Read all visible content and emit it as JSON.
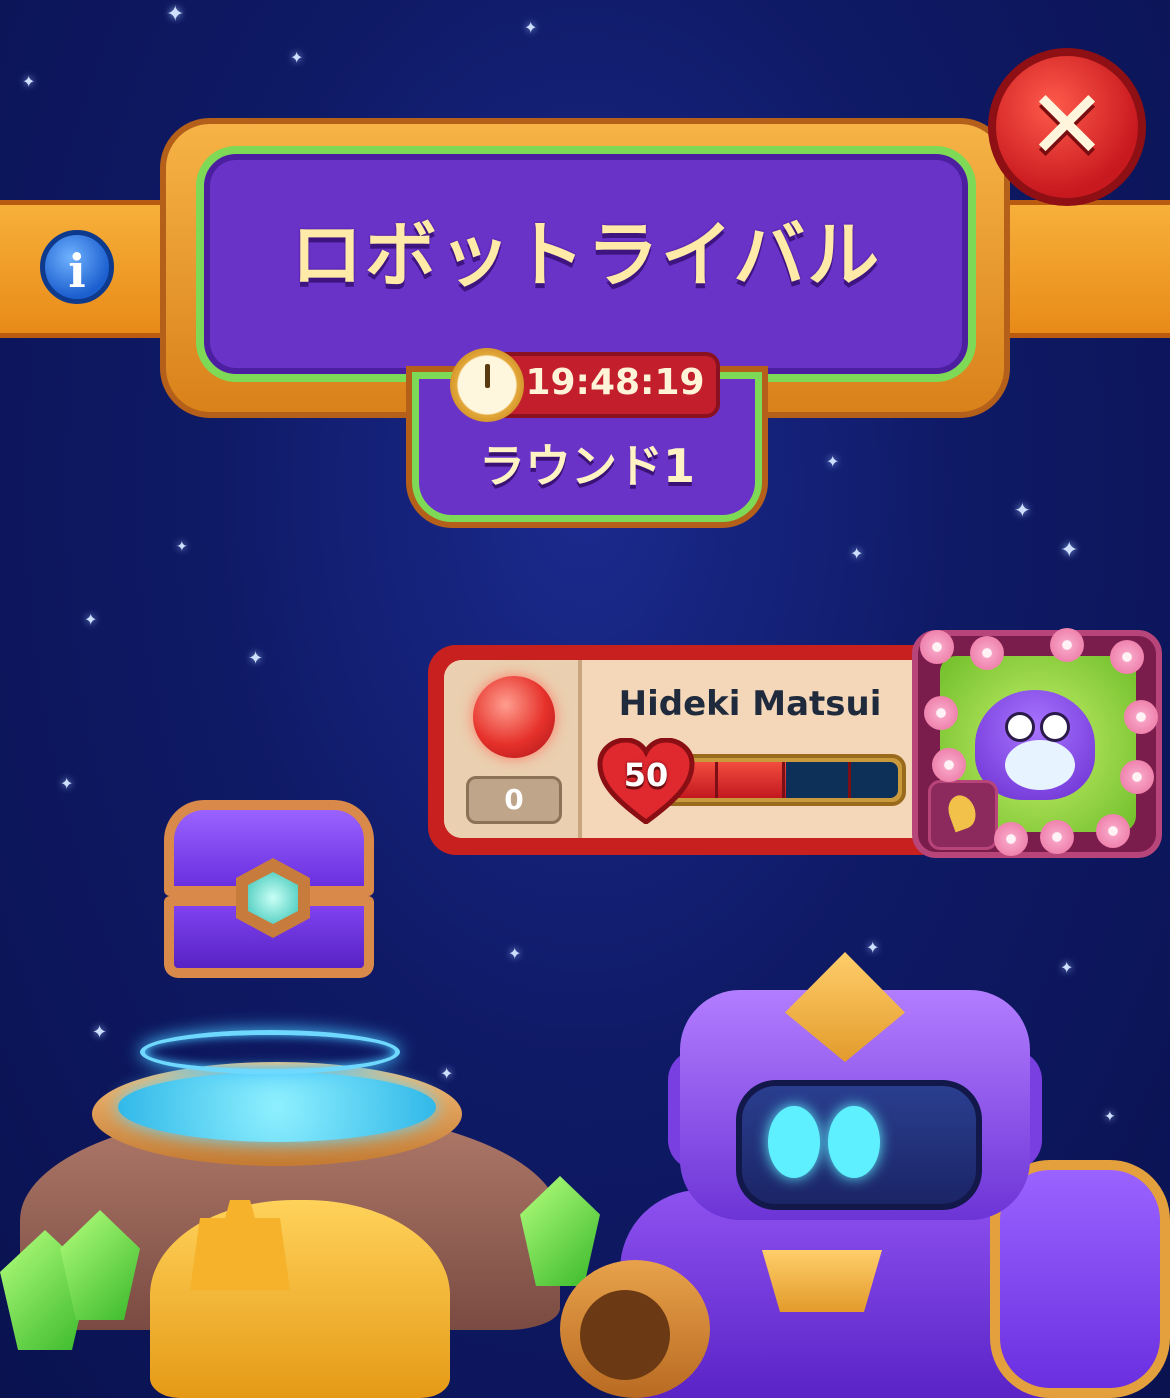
{
  "header": {
    "title": "ロボットライバル",
    "timer": "19:48:19",
    "round_label": "ラウンド1"
  },
  "player": {
    "name": "Hideki Matsui",
    "gem_count": "0",
    "health": "50",
    "health_fill_fraction": 0.55
  },
  "icons": {
    "info": "info-icon",
    "close": "close-icon",
    "clock": "clock-icon",
    "heart": "heart-icon",
    "gem": "red-orb-icon",
    "leaf": "leaf-icon"
  },
  "colors": {
    "background": "#0f1a66",
    "accent_purple": "#6a33c8",
    "accent_orange": "#e88a18",
    "accent_green": "#7ed957",
    "timer_red": "#c21e2c",
    "health_red": "#c21820",
    "close_red": "#c8191f"
  }
}
